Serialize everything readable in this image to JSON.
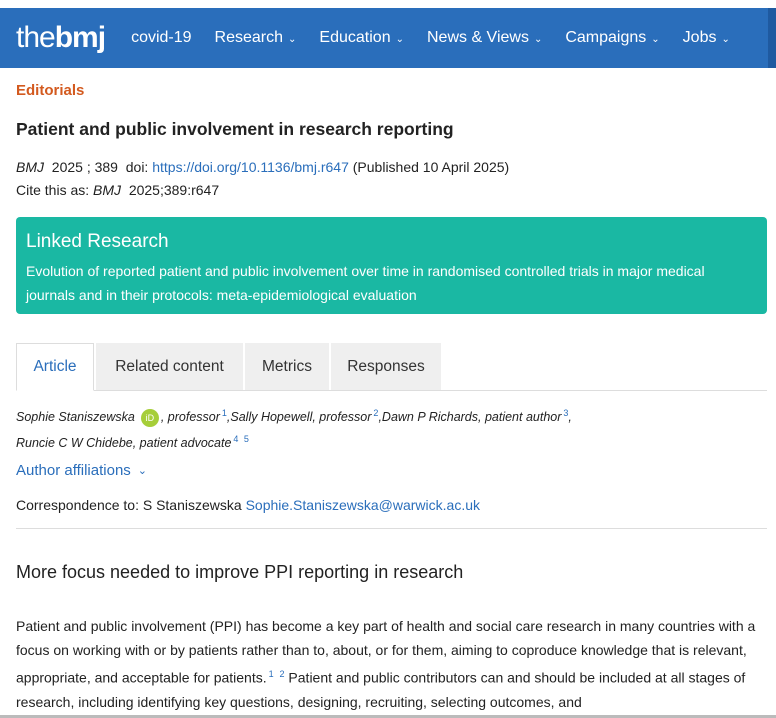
{
  "nav": {
    "logo_the": "the",
    "logo_bmj": "bmj",
    "items": [
      {
        "label": "covid-19",
        "has_chevron": false
      },
      {
        "label": "Research",
        "has_chevron": true
      },
      {
        "label": "Education",
        "has_chevron": true
      },
      {
        "label": "News & Views",
        "has_chevron": true
      },
      {
        "label": "Campaigns",
        "has_chevron": true
      },
      {
        "label": "Jobs",
        "has_chevron": true
      }
    ],
    "chevron_icon": "chevron-down-icon",
    "bg_color": "#2a6ebb"
  },
  "article": {
    "section": "Editorials",
    "title": "Patient and public involvement in research reporting",
    "journal": "BMJ",
    "year": "2025",
    "volume_sep": "; 389",
    "doi_label": "doi:",
    "doi_link": "https://doi.org/10.1136/bmj.r647",
    "published": "(Published 10 April 2025)",
    "cite_label": "Cite this as:",
    "cite_journal": "BMJ",
    "cite_ref": "2025;389:r647"
  },
  "linked_research": {
    "heading": "Linked Research",
    "text": "Evolution of reported patient and public involvement over time in randomised controlled trials in major medical journals and in their protocols: meta-epidemiological evaluation",
    "color": "#1ab8a3"
  },
  "tabs": [
    {
      "label": "Article",
      "active": true
    },
    {
      "label": "Related content",
      "active": false
    },
    {
      "label": "Metrics",
      "active": false
    },
    {
      "label": "Responses",
      "active": false
    }
  ],
  "authors": {
    "a1_name": "Sophie Staniszewska",
    "orcid_label": "iD",
    "a1_role": ", professor",
    "a1_sup": "1",
    "a2": ",Sally Hopewell, professor",
    "a2_sup": "2",
    "a3": ",Dawn P Richards, patient author",
    "a3_sup": "3",
    "a3_trail": ",",
    "a4": "Runcie C W Chidebe, patient advocate",
    "a4_sup1": "4",
    "a4_sup2": "5"
  },
  "affiliations_label": "Author affiliations",
  "correspondence": {
    "label": "Correspondence to: S Staniszewska",
    "email": "Sophie.Staniszewska@warwick.ac.uk"
  },
  "subheading": "More focus needed to improve PPI reporting in research",
  "body": {
    "p1_part1": "Patient and public involvement (PPI) has become a key part of health and social care research in many countries with a focus on working with or by patients rather than to, about, or for them, aiming to coproduce knowledge that is relevant, appropriate, and acceptable for patients.",
    "ref1": "1",
    "ref2": "2",
    "p1_part2": " Patient and public contributors can and should be included at all stages of research, including identifying key questions, designing, recruiting, selecting outcomes, and"
  }
}
